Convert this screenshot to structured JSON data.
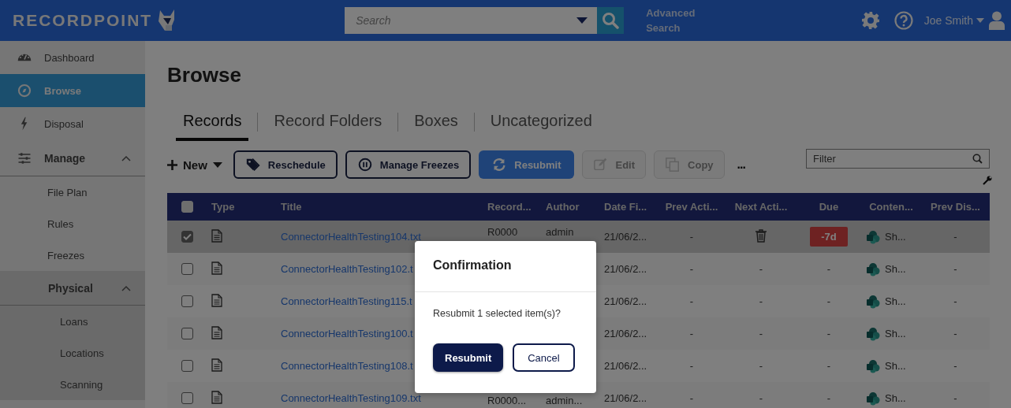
{
  "header": {
    "logo": "RECORDPOINT",
    "search_placeholder": "Search",
    "advanced_search": "Advanced Search",
    "user": "Joe Smith"
  },
  "sidebar": {
    "items": [
      {
        "label": "Dashboard",
        "selected": false
      },
      {
        "label": "Browse",
        "selected": true
      },
      {
        "label": "Disposal",
        "selected": false
      },
      {
        "label": "Manage",
        "selected": false,
        "expanded": true,
        "children": [
          {
            "label": "File Plan",
            "selected": false
          },
          {
            "label": "Rules",
            "selected": false
          },
          {
            "label": "Freezes",
            "selected": false
          },
          {
            "label": "Physical",
            "selected": false,
            "expanded": true,
            "children": [
              {
                "label": "Loans",
                "selected": false
              },
              {
                "label": "Locations",
                "selected": false
              },
              {
                "label": "Scanning",
                "selected": false
              }
            ]
          }
        ]
      }
    ]
  },
  "page_title": "Browse",
  "tabs": [
    {
      "label": "Records",
      "selected": true
    },
    {
      "label": "Record Folders",
      "selected": false
    },
    {
      "label": "Boxes",
      "selected": false
    },
    {
      "label": "Uncategorized",
      "selected": false
    }
  ],
  "toolbar": {
    "new": "New",
    "buttons": [
      {
        "label": "Reschedule",
        "kind": "outline"
      },
      {
        "label": "Manage Freezes",
        "kind": "outline"
      },
      {
        "label": "Resubmit",
        "kind": "primary"
      },
      {
        "label": "Edit",
        "kind": "disabled"
      },
      {
        "label": "Copy",
        "kind": "disabled"
      }
    ],
    "more": "...",
    "filter_placeholder": "Filter"
  },
  "table": {
    "select_all_checked": false,
    "columns": [
      "Type",
      "Title",
      "Record...",
      "Author",
      "Date Fi...",
      "Prev Acti...",
      "Next Acti...",
      "Due",
      "Conten...",
      "Prev Dis..."
    ],
    "rows": [
      {
        "checked": true,
        "selected": true,
        "title": "ConnectorHealthTesting104.txt",
        "record": "R0000",
        "author": "admin",
        "date": "21/06/2...",
        "prev_action": "-",
        "next_action": {
          "kind": "icon"
        },
        "due": {
          "text": "-7d",
          "overdue": true
        },
        "content": "Sh...",
        "prev_disposal": "-"
      },
      {
        "checked": false,
        "selected": false,
        "title": "ConnectorHealthTesting102.t",
        "date": "21/06/2...",
        "prev_action": "-",
        "next_action": {
          "kind": "text",
          "text": "-"
        },
        "due": {
          "text": "-",
          "overdue": false
        },
        "content": "Sh...",
        "prev_disposal": "-"
      },
      {
        "checked": false,
        "selected": false,
        "title": "ConnectorHealthTesting115.t",
        "date": "21/06/2...",
        "prev_action": "-",
        "next_action": {
          "kind": "text",
          "text": "-"
        },
        "due": {
          "text": "-",
          "overdue": false
        },
        "content": "Sh...",
        "prev_disposal": "-"
      },
      {
        "checked": false,
        "selected": false,
        "title": "ConnectorHealthTesting100.t",
        "date": "21/06/2...",
        "prev_action": "-",
        "next_action": {
          "kind": "text",
          "text": "-"
        },
        "due": {
          "text": "-",
          "overdue": false
        },
        "content": "Sh...",
        "prev_disposal": "-"
      },
      {
        "checked": false,
        "selected": false,
        "title": "ConnectorHealthTesting108.t",
        "date": "21/06/2...",
        "prev_action": "-",
        "next_action": {
          "kind": "text",
          "text": "-"
        },
        "due": {
          "text": "-",
          "overdue": false
        },
        "content": "Sh...",
        "prev_disposal": "-"
      },
      {
        "checked": false,
        "selected": false,
        "title": "ConnectorHealthTesting109.txt",
        "record": "R0000...",
        "author": "admin...",
        "date": "21/06/2...",
        "prev_action": "-",
        "next_action": {
          "kind": "text",
          "text": "-"
        },
        "due": {
          "text": "-",
          "overdue": false
        },
        "content": "Sh...",
        "prev_disposal": "-"
      }
    ]
  },
  "dialog": {
    "title": "Confirmation",
    "message": "Resubmit 1 selected item(s)?",
    "buttons": [
      {
        "label": "Resubmit",
        "kind": "primary"
      },
      {
        "label": "Cancel",
        "kind": "secondary"
      }
    ]
  }
}
